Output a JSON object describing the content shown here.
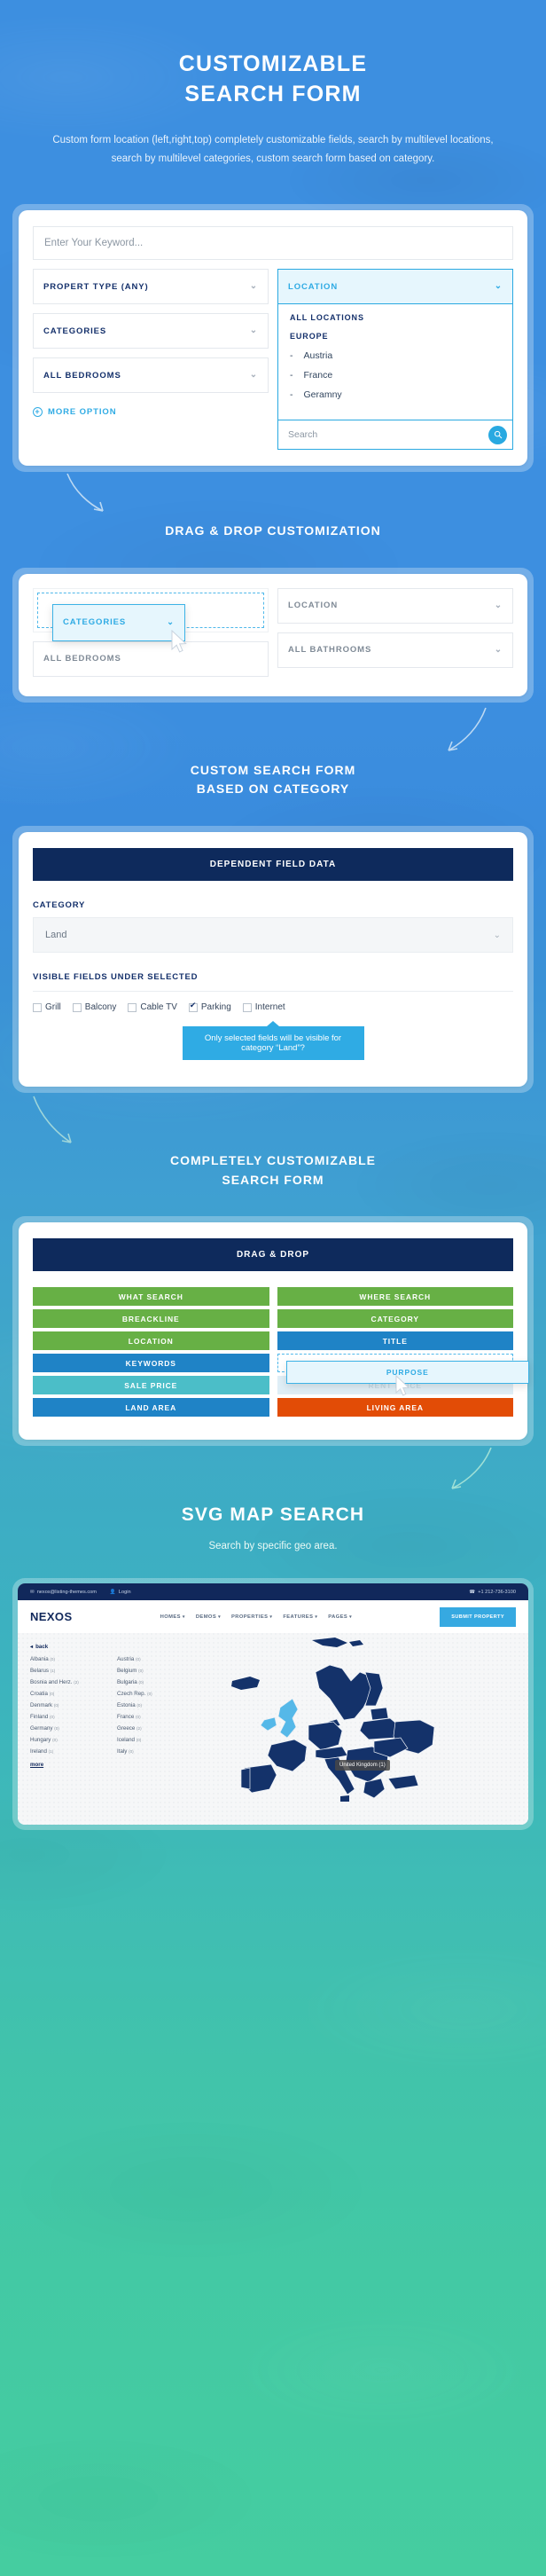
{
  "hero": {
    "title_line1": "CUSTOMIZABLE",
    "title_line2": "SEARCH FORM",
    "description": "Custom form location (left,right,top) completely customizable fields, search by multilevel locations, search by multilevel categories, custom search form based on category."
  },
  "search_form": {
    "keyword_placeholder": "Enter Your Keyword...",
    "property_type_label": "PROPERT TYPE (ANY)",
    "location_label": "LOCATION",
    "categories_label": "CATEGORIES",
    "all_bedrooms_label": "ALL BEDROOMS",
    "more_option_label": "MORE OPTION",
    "dropdown": {
      "all_locations": "ALL LOCATIONS",
      "region": "EUROPE",
      "items": [
        "Austria",
        "France",
        "Geramny"
      ],
      "search_placeholder": "Search",
      "search_icon": "magnifier-icon"
    }
  },
  "dragdrop_section": {
    "title": "DRAG & DROP CUSTOMIZATION",
    "floating_field": "CATEGORIES",
    "fields": {
      "location": "LOCATION",
      "all_bedrooms": "ALL BEDROOMS",
      "all_bathrooms": "ALL BATHROOMS"
    }
  },
  "category_section": {
    "title_line1": "CUSTOM SEARCH FORM",
    "title_line2": "BASED ON CATEGORY",
    "panel_header": "DEPENDENT FIELD DATA",
    "category_label": "CATEGORY",
    "category_value": "Land",
    "visible_fields_label": "VISIBLE FIELDS UNDER SELECTED",
    "checkboxes": [
      {
        "label": "Grill",
        "checked": false
      },
      {
        "label": "Balcony",
        "checked": false
      },
      {
        "label": "Cable TV",
        "checked": false
      },
      {
        "label": "Parking",
        "checked": true
      },
      {
        "label": "Internet",
        "checked": false
      }
    ],
    "tooltip": "Only selected fields will be visible for category “Land”?"
  },
  "customizable_section": {
    "title_line1": "COMPLETELY CUSTOMIZABLE",
    "title_line2": "SEARCH FORM",
    "panel_header": "DRAG & DROP",
    "left_tiles": [
      {
        "label": "WHAT SEARCH",
        "color": "#67b045"
      },
      {
        "label": "BREACKLINE",
        "color": "#67b045"
      },
      {
        "label": "LOCATION",
        "color": "#67b045"
      },
      {
        "label": "KEYWORDS",
        "color": "#1f83c6"
      },
      {
        "label": "SALE PRICE",
        "color": "#4bbec8"
      },
      {
        "label": "LAND AREA",
        "color": "#1f83c6"
      }
    ],
    "right_tiles": [
      {
        "label": "WHERE SEARCH",
        "color": "#67b045"
      },
      {
        "label": "CATEGORY",
        "color": "#67b045"
      },
      {
        "label": "TITLE",
        "color": "#1f83c6"
      },
      {
        "label": "RENT PRICE",
        "color": "#dfeef6",
        "ghost": true
      },
      {
        "label": "LIVING AREA",
        "color": "#e24c06"
      }
    ],
    "dragging_tile": "PURPOSE"
  },
  "map_section": {
    "title": "SVG MAP SEARCH",
    "subtitle": "Search by specific geo area.",
    "browser": {
      "topbar": {
        "email": "nexos@listing-themes.com",
        "email_icon": "envelope-icon",
        "login": "Login",
        "login_icon": "user-icon",
        "phone": "+1 212-736-3100",
        "phone_icon": "phone-icon"
      },
      "logo": "NEXOS",
      "menu": [
        "HOMES",
        "DEMOS",
        "PROPERTIES",
        "FEATURES",
        "PAGES"
      ],
      "submit_button": "SUBMIT PROPERTY",
      "back_link": "back",
      "more_link": "more",
      "map_tooltip": "United Kingdom (1)",
      "countries": [
        {
          "name": "Albania",
          "count": "(0)"
        },
        {
          "name": "Austria",
          "count": "(0)"
        },
        {
          "name": "Belarus",
          "count": "(1)"
        },
        {
          "name": "Belgium",
          "count": "(0)"
        },
        {
          "name": "Bosnia and Herz.",
          "count": "(2)"
        },
        {
          "name": "Bulgaria",
          "count": "(0)"
        },
        {
          "name": "Croatia",
          "count": "(0)"
        },
        {
          "name": "Czech Rep.",
          "count": "(0)"
        },
        {
          "name": "Denmark",
          "count": "(0)"
        },
        {
          "name": "Estonia",
          "count": "(0)"
        },
        {
          "name": "Finland",
          "count": "(0)"
        },
        {
          "name": "France",
          "count": "(0)"
        },
        {
          "name": "Germany",
          "count": "(0)"
        },
        {
          "name": "Greece",
          "count": "(2)"
        },
        {
          "name": "Hungary",
          "count": "(0)"
        },
        {
          "name": "Iceland",
          "count": "(0)"
        },
        {
          "name": "Ireland",
          "count": "(1)"
        },
        {
          "name": "Italy",
          "count": "(0)"
        }
      ]
    }
  },
  "colors": {
    "accent_blue": "#2fabe4",
    "navy": "#0e2a5c",
    "green": "#67b045",
    "orange": "#e24c06",
    "teal": "#4bbec8"
  }
}
